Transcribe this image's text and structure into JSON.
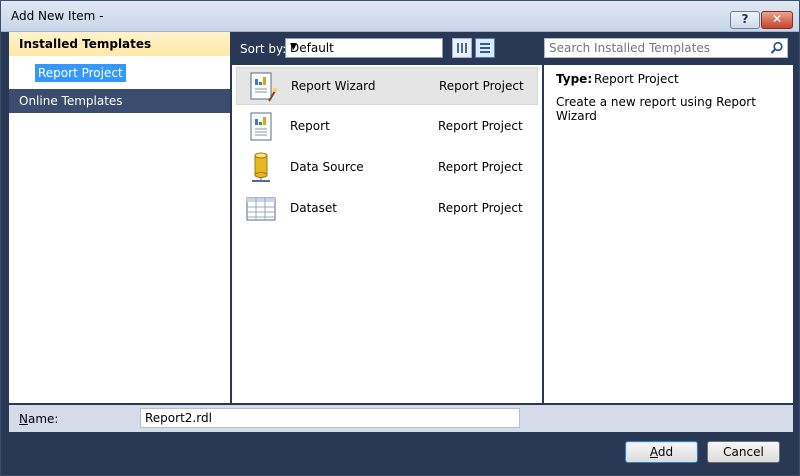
{
  "window": {
    "title": "Add New Item -"
  },
  "titlebar": {
    "help_label": "?",
    "close_label": "✕"
  },
  "sidebar": {
    "installed_header": "Installed Templates",
    "installed_item": "Report Project",
    "online_header": "Online Templates"
  },
  "toolbar": {
    "sort_label": "Sort by:",
    "sort_value": "Default"
  },
  "search": {
    "placeholder": "Search Installed Templates"
  },
  "templates": [
    {
      "name": "Report Wizard",
      "category": "Report Project",
      "icon": "report-wizard-icon"
    },
    {
      "name": "Report",
      "category": "Report Project",
      "icon": "report-icon"
    },
    {
      "name": "Data Source",
      "category": "Report Project",
      "icon": "database-icon"
    },
    {
      "name": "Dataset",
      "category": "Report Project",
      "icon": "dataset-icon"
    }
  ],
  "details": {
    "type_label": "Type:",
    "type_value": "Report Project",
    "description": "Create a new report using Report Wizard"
  },
  "name_field": {
    "label_underlined": "N",
    "label_rest": "ame:",
    "value": "Report2.rdl"
  },
  "buttons": {
    "add_underlined": "A",
    "add_rest": "dd",
    "cancel": "Cancel"
  },
  "colors": {
    "accent": "#3399ff",
    "frame": "#293955",
    "selection": "#ffe9a8"
  }
}
